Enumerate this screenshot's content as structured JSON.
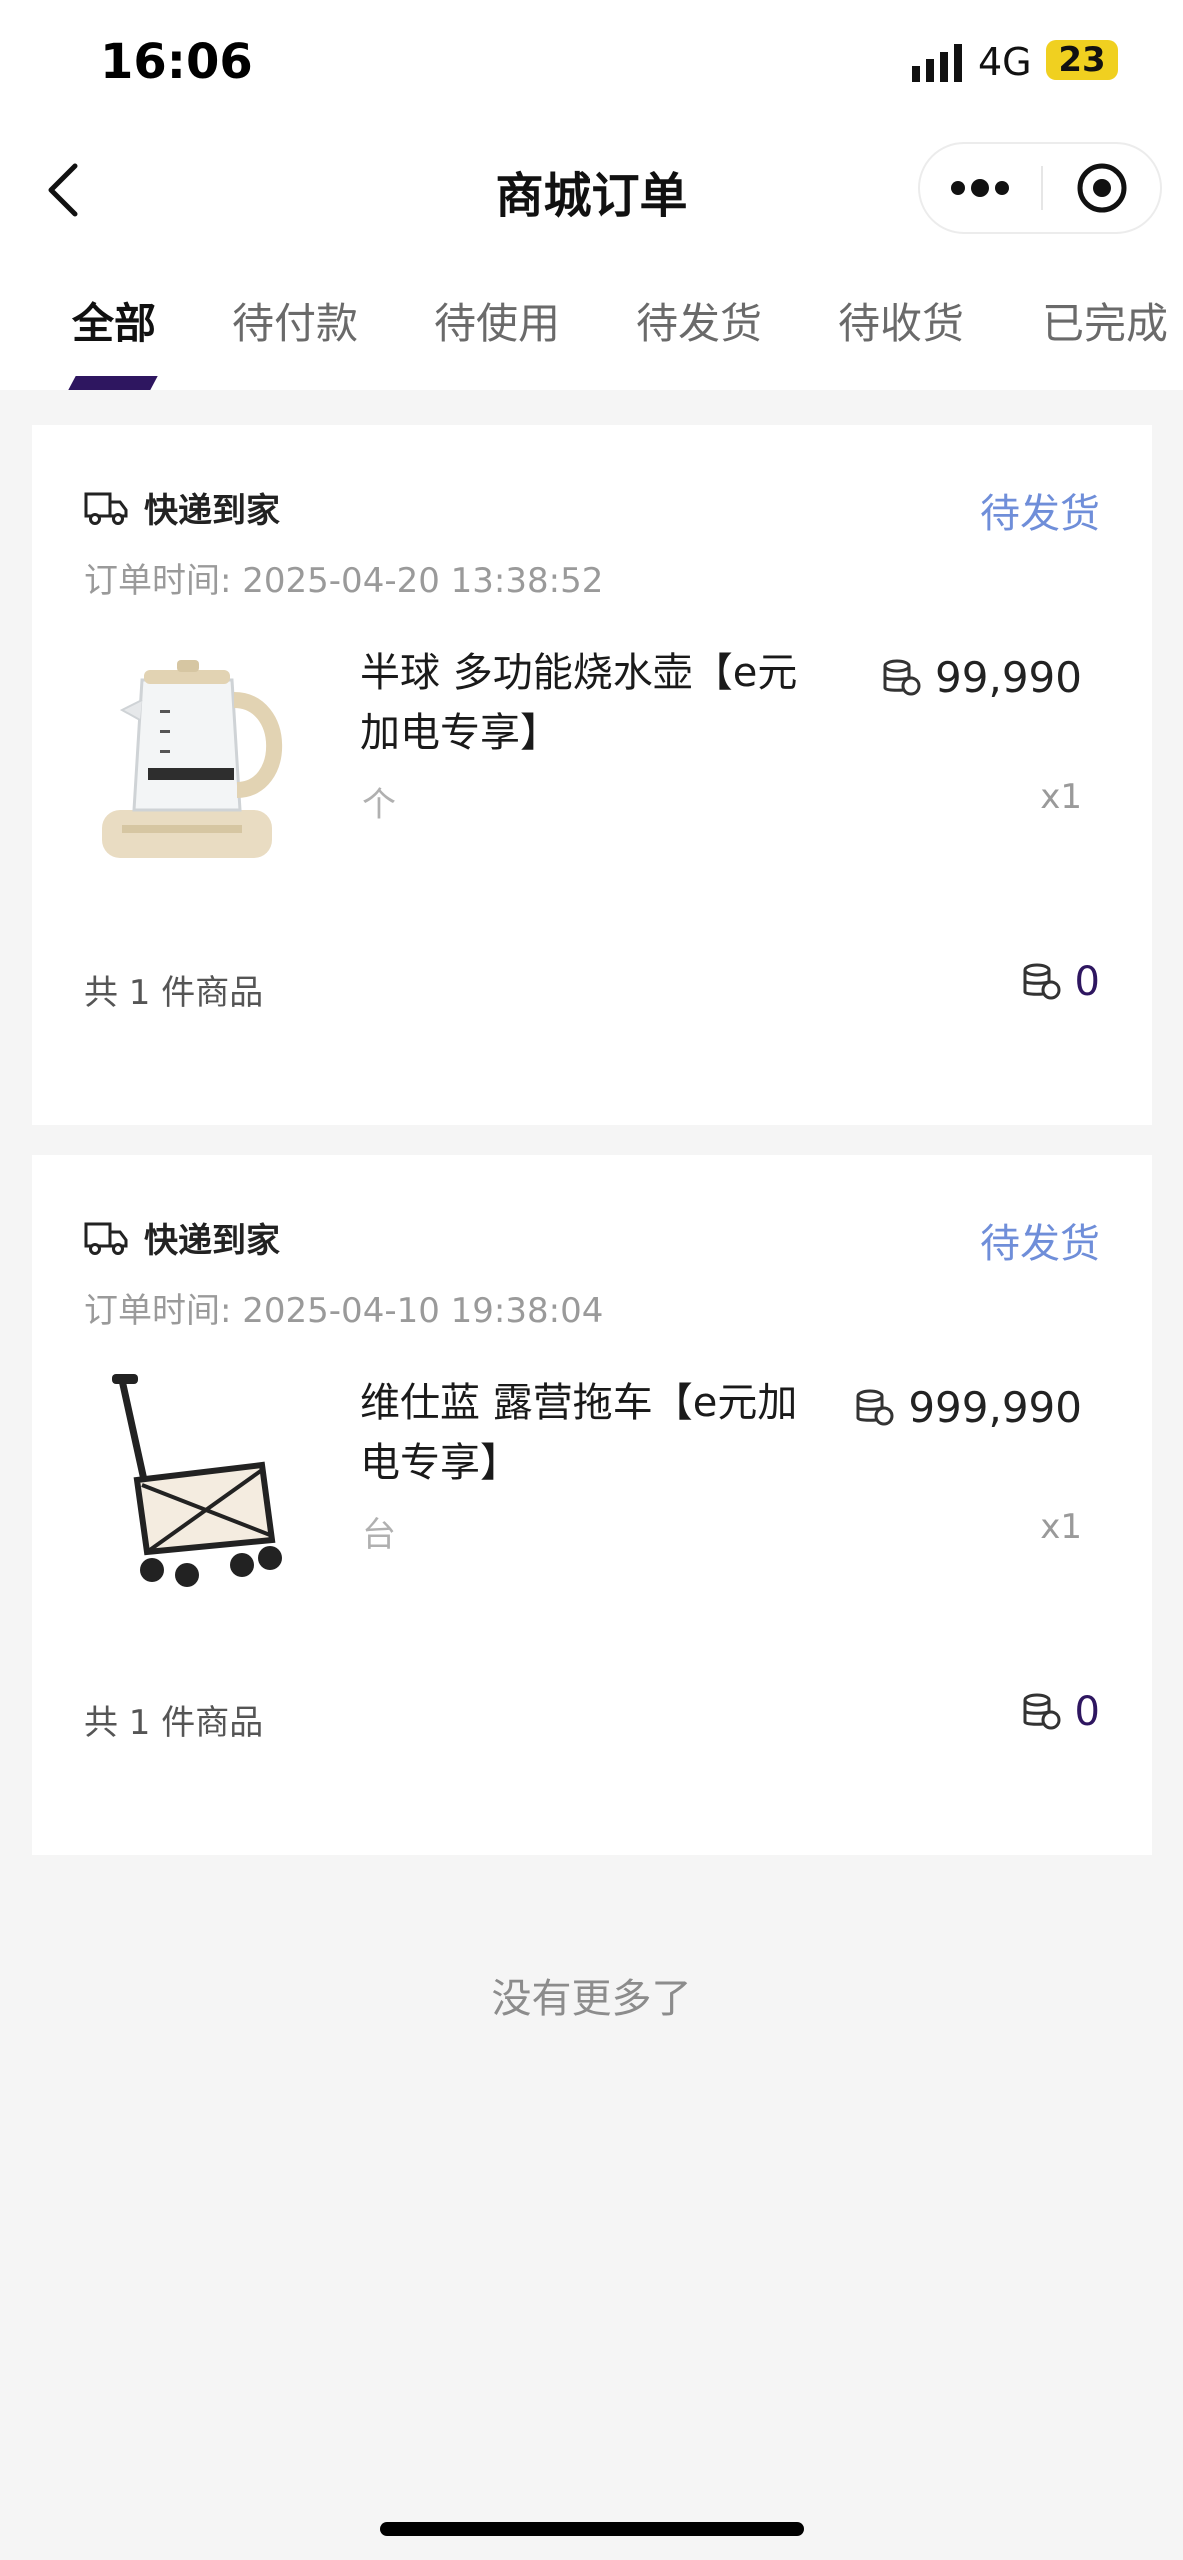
{
  "status_bar": {
    "time": "16:06",
    "network": "4G",
    "battery": "23"
  },
  "nav": {
    "title": "商城订单"
  },
  "tabs": [
    "全部",
    "待付款",
    "待使用",
    "待发货",
    "待收货",
    "已完成"
  ],
  "active_tab": "全部",
  "orders": [
    {
      "shipping_label": "快递到家",
      "status": "待发货",
      "order_time": "订单时间: 2025-04-20 13:38:52",
      "product_name": "半球 多功能烧水壶【e元加电专享】",
      "unit": "个",
      "price": "99,990",
      "quantity": "x1",
      "item_count": "共 1 件商品",
      "total": "0"
    },
    {
      "shipping_label": "快递到家",
      "status": "待发货",
      "order_time": "订单时间: 2025-04-10 19:38:04",
      "product_name": "维仕蓝 露营拖车【e元加电专享】",
      "unit": "台",
      "price": "999,990",
      "quantity": "x1",
      "item_count": "共 1 件商品",
      "total": "0"
    }
  ],
  "footer": {
    "no_more": "没有更多了"
  },
  "colors": {
    "accent": "#2e1660",
    "status_blue": "#6f8ed9",
    "background": "#f5f5f5"
  },
  "icons": [
    "back-chevron-icon",
    "more-dots-icon",
    "target-circle-icon",
    "truck-icon",
    "coin-stack-icon"
  ]
}
